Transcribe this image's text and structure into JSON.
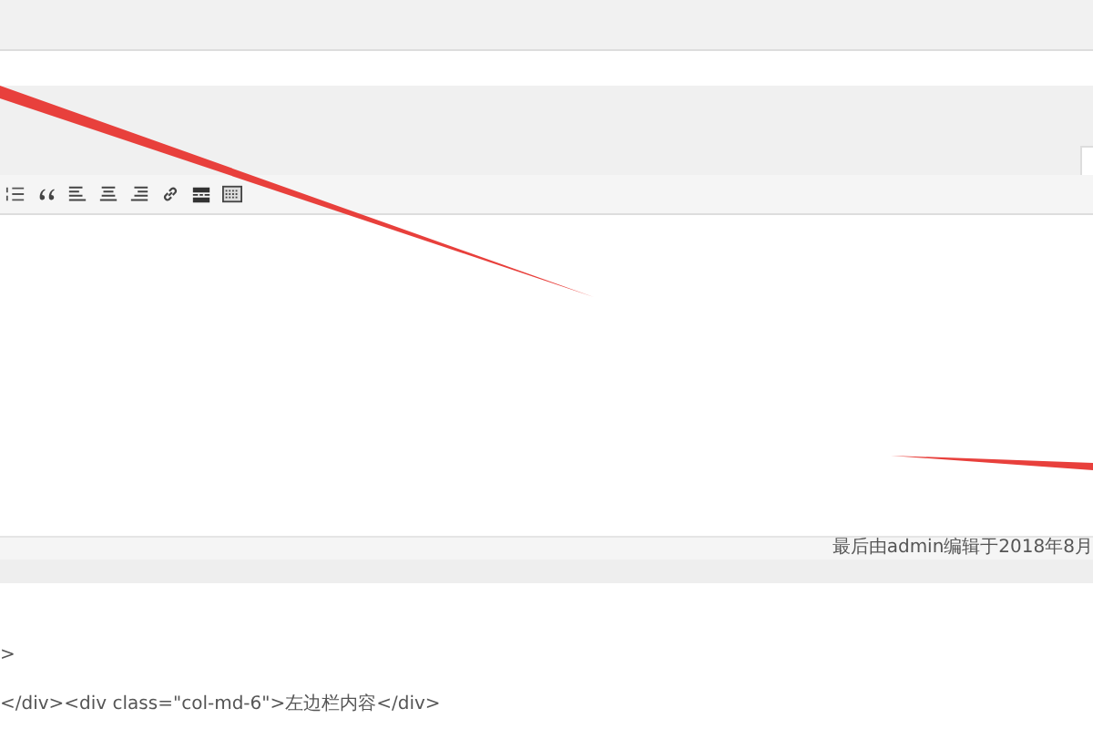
{
  "editor_tab": {
    "selected": true
  },
  "toolbar": [
    {
      "kind": "numbered-list"
    },
    {
      "kind": "quote"
    },
    {
      "kind": "align-left"
    },
    {
      "kind": "align-center"
    },
    {
      "kind": "align-right"
    },
    {
      "kind": "link"
    },
    {
      "kind": "more"
    },
    {
      "kind": "toolbar-toggle"
    }
  ],
  "status_bar": {
    "last_edited": "最后由admin编辑于2018年8月"
  },
  "code_lines": [
    ">",
    "</div><div class=\"col-md-6\">左边栏内容</div>"
  ]
}
